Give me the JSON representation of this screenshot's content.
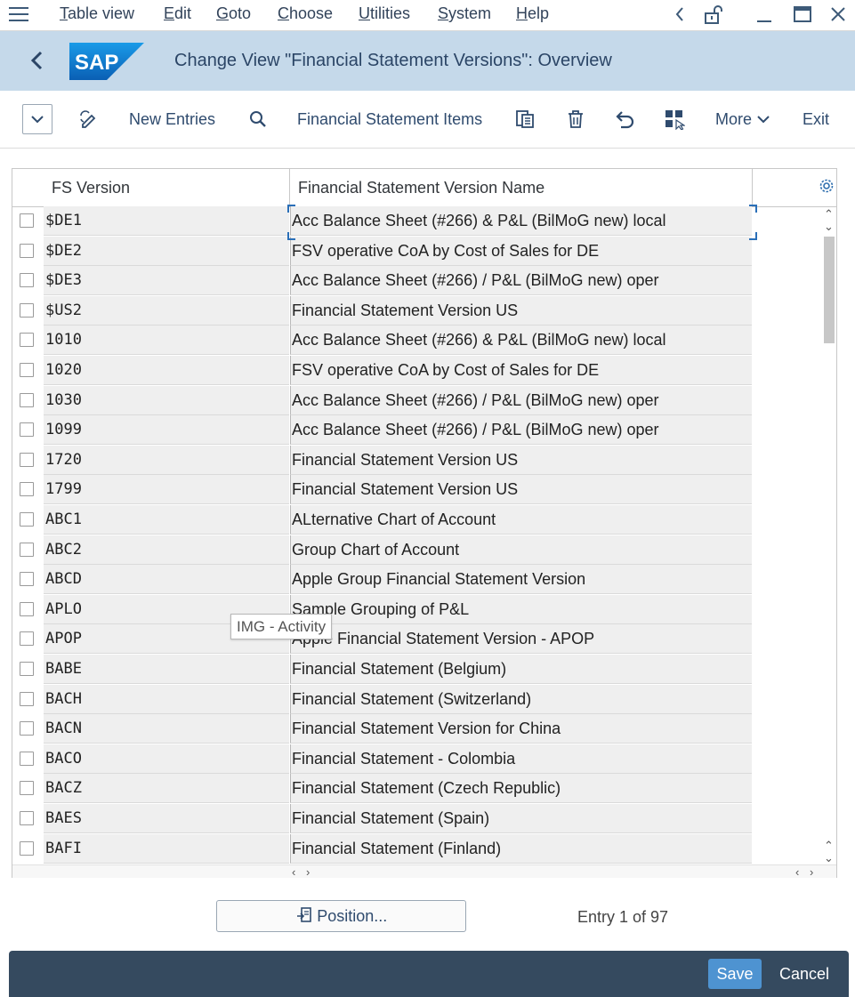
{
  "menu": {
    "items": [
      "Table view",
      "Edit",
      "Goto",
      "Choose",
      "Utilities",
      "System",
      "Help"
    ]
  },
  "header": {
    "logo_text": "SAP",
    "title": "Change View \"Financial Statement Versions\": Overview"
  },
  "toolbar": {
    "new_entries": "New Entries",
    "fs_items": "Financial Statement Items",
    "more": "More",
    "exit": "Exit"
  },
  "table": {
    "columns": [
      "FS Version",
      "Financial Statement Version Name"
    ],
    "rows": [
      {
        "version": "$DE1",
        "name": "Acc Balance Sheet (#266) & P&L (BilMoG new) local"
      },
      {
        "version": "$DE2",
        "name": "FSV operative CoA by Cost of Sales for DE"
      },
      {
        "version": "$DE3",
        "name": "Acc Balance Sheet (#266) / P&L (BilMoG new) oper"
      },
      {
        "version": "$US2",
        "name": "Financial Statement Version US"
      },
      {
        "version": "1010",
        "name": "Acc Balance Sheet (#266) & P&L (BilMoG new) local"
      },
      {
        "version": "1020",
        "name": "FSV operative CoA by Cost of Sales for DE"
      },
      {
        "version": "1030",
        "name": "Acc Balance Sheet (#266) / P&L (BilMoG new) oper"
      },
      {
        "version": "1099",
        "name": "Acc Balance Sheet (#266) / P&L (BilMoG new) oper"
      },
      {
        "version": "1720",
        "name": "Financial Statement Version US"
      },
      {
        "version": "1799",
        "name": "Financial Statement Version US"
      },
      {
        "version": "ABC1",
        "name": "ALternative Chart of Account"
      },
      {
        "version": "ABC2",
        "name": "Group Chart of Account"
      },
      {
        "version": "ABCD",
        "name": "Apple Group Financial Statement Version"
      },
      {
        "version": "APLO",
        "name": "Sample Grouping of P&L"
      },
      {
        "version": "APOP",
        "name": "Apple Financial Statement Version - APOP"
      },
      {
        "version": "BABE",
        "name": "Financial Statement (Belgium)"
      },
      {
        "version": "BACH",
        "name": "Financial Statement (Switzerland)"
      },
      {
        "version": "BACN",
        "name": "Financial Statement Version for China"
      },
      {
        "version": "BACO",
        "name": "Financial Statement - Colombia"
      },
      {
        "version": "BACZ",
        "name": "Financial Statement (Czech Republic)"
      },
      {
        "version": "BAES",
        "name": "Financial Statement (Spain)"
      },
      {
        "version": "BAFI",
        "name": "Financial Statement (Finland)"
      }
    ]
  },
  "tooltip": "IMG - Activity",
  "position_button": "Position...",
  "entry_info": "Entry 1 of 97",
  "footer": {
    "save": "Save",
    "cancel": "Cancel"
  },
  "colors": {
    "title_bar": "#c5d9ea",
    "footer": "#354a5f",
    "save_button": "#4e93d1",
    "brand_blue": "#1a7bd5"
  }
}
